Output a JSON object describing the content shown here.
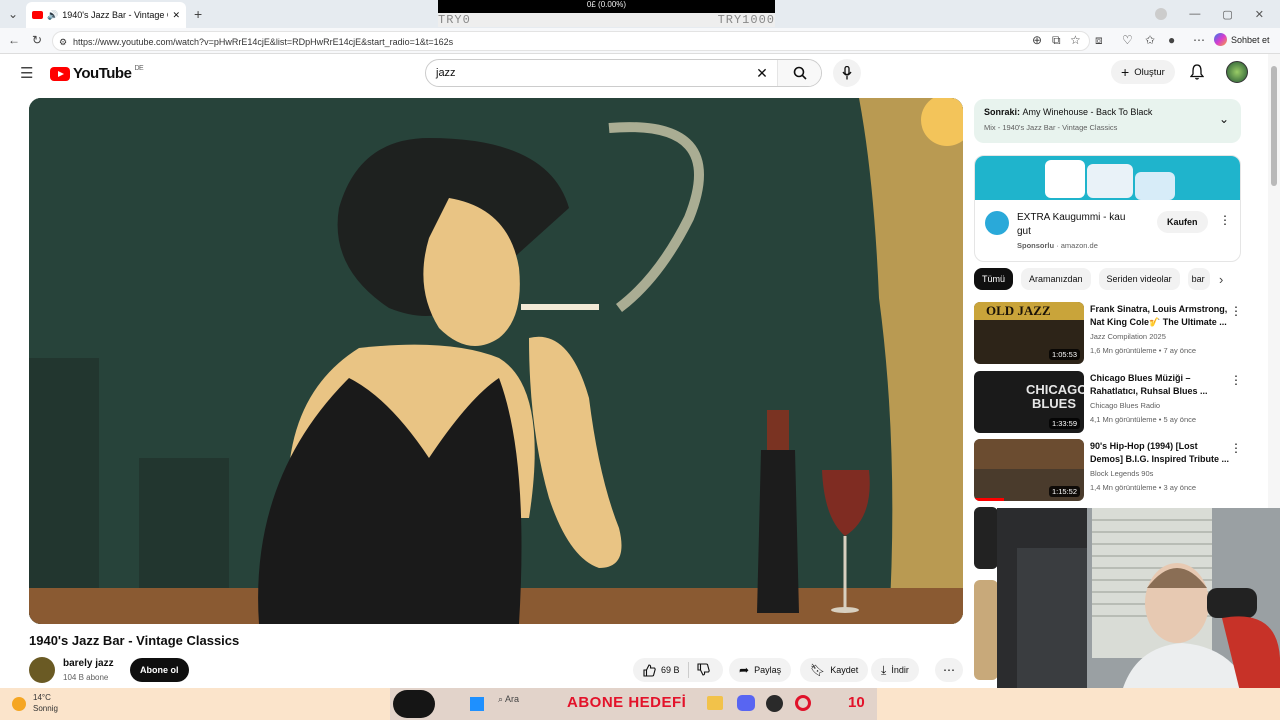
{
  "browser": {
    "tab_title": "1940's Jazz Bar - Vintage Clas",
    "url": "https://www.youtube.com/watch?v=pHwRrE14cjE&list=RDpHwRrE14cjE&start_radio=1&t=162s",
    "copilot_label": "Sohbet et"
  },
  "ticker": {
    "top": "0£ (0.00%)",
    "left": "TRY0",
    "right": "TRY1000"
  },
  "youtube": {
    "logo_text": "YouTube",
    "region": "DE",
    "search_value": "jazz",
    "create_label": "Oluştur"
  },
  "video": {
    "title": "1940's Jazz Bar - Vintage Classics",
    "channel": "barely jazz",
    "subscribers": "104 B abone",
    "subscribe_label": "Abone ol",
    "likes": "69 B",
    "share_label": "Paylaş",
    "save_label": "Kaydet",
    "download_label": "İndir"
  },
  "up_next": {
    "prefix": "Sonraki:",
    "title": "Amy Winehouse - Back To Black",
    "mix": "Mix - 1940's Jazz Bar - Vintage Classics"
  },
  "ad": {
    "title": "EXTRA Kaugummi - kau gut",
    "sponsored": "Sponsorlu",
    "domain": "amazon.de",
    "button": "Kaufen"
  },
  "chips": [
    "Tümü",
    "Aramanızdan",
    "Seriden videolar",
    "bar"
  ],
  "recommendations": [
    {
      "title": "Frank Sinatra, Louis Armstrong, Nat King Cole🎷 The Ultimate ...",
      "channel": "Jazz Compilation 2025",
      "views": "1,6 Mn görüntüleme",
      "age": "7 ay önce",
      "duration": "1:05:53",
      "thumb_text": "OLD JAZZ"
    },
    {
      "title": "Chicago Blues Müziği – Rahatlatıcı, Ruhsal Blues ...",
      "channel": "Chicago Blues Radio",
      "views": "4,1 Mn görüntüleme",
      "age": "5 ay önce",
      "duration": "1:33:59",
      "thumb_text": "CHICAGO BLUES"
    },
    {
      "title": "90's Hip-Hop (1994) [Lost Demos] B.I.G. Inspired Tribute ...",
      "channel": "Block Legends 90s",
      "views": "1,4 Mn görüntüleme",
      "age": "3 ay önce",
      "duration": "1:15:52",
      "thumb_text": ""
    }
  ],
  "taskbar": {
    "temperature": "14°C",
    "weather": "Sonnig",
    "search": "Ara",
    "overlay_text": "ABONE HEDEFİ",
    "overlay_count": "10"
  }
}
